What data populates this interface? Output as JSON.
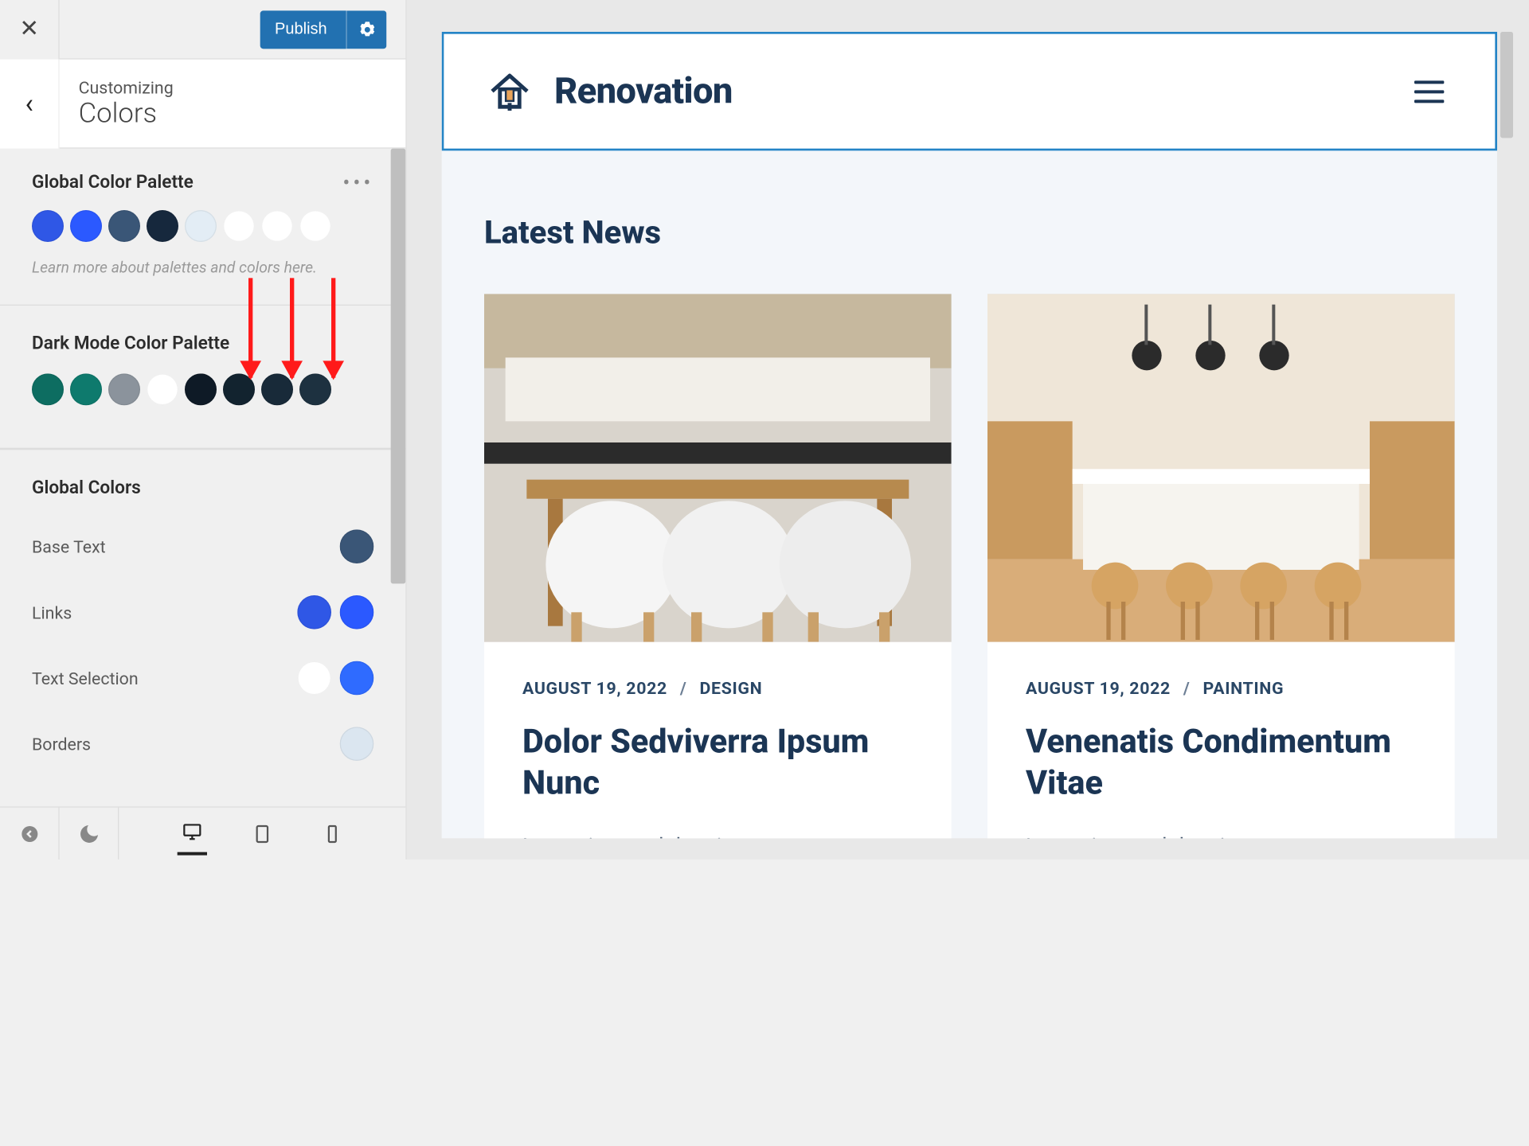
{
  "sidebar": {
    "publish_label": "Publish",
    "customizing_label": "Customizing",
    "section_title": "Colors",
    "global_palette": {
      "title": "Global Color Palette",
      "colors": [
        "#2f57e6",
        "#2b59ff",
        "#3a5677",
        "#16283d",
        "#e3edf5",
        "#ffffff",
        "#ffffff",
        "#ffffff"
      ],
      "hint": "Learn more about palettes and colors here."
    },
    "dark_palette": {
      "title": "Dark Mode Color Palette",
      "colors": [
        "#0d6d61",
        "#0e7a6d",
        "#8b939c",
        "#ffffff",
        "#0e1a26",
        "#12232f",
        "#182a39",
        "#1d3140"
      ]
    },
    "global_colors": {
      "title": "Global Colors",
      "items": [
        {
          "label": "Base Text",
          "values": [
            "#3a5677"
          ]
        },
        {
          "label": "Links",
          "values": [
            "#2f57e6",
            "#2b59ff"
          ]
        },
        {
          "label": "Text Selection",
          "values": [
            "#ffffff",
            "#2f6bff"
          ]
        },
        {
          "label": "Borders",
          "values": [
            "#dbe6f0"
          ]
        }
      ]
    }
  },
  "preview": {
    "brand": "Renovation",
    "heading": "Latest News",
    "cards": [
      {
        "date": "AUGUST 19, 2022",
        "category": "DESIGN",
        "title": "Dolor Sedviverra Ipsum Nunc",
        "excerpt": "Lorem ipsum dolor sit amet, consectetur adipiscing elit, sed do"
      },
      {
        "date": "AUGUST 19, 2022",
        "category": "PAINTING",
        "title": "Venenatis Condimentum Vitae",
        "excerpt": "Lorem ipsum dolor sit amet,"
      }
    ]
  }
}
